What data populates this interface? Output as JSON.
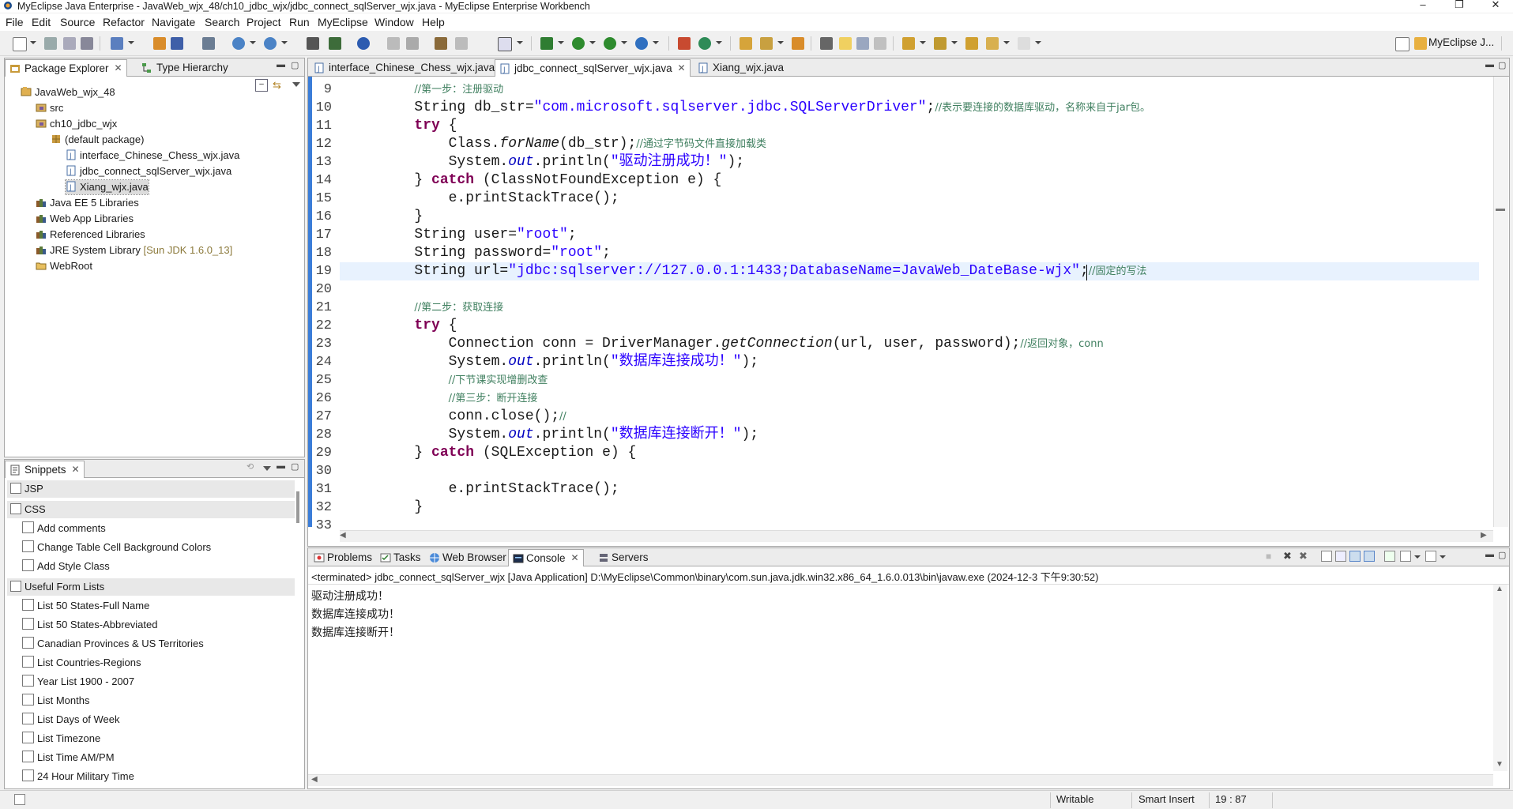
{
  "window": {
    "title": "MyEclipse Java Enterprise - JavaWeb_wjx_48/ch10_jdbc_wjx/jdbc_connect_sqlServer_wjx.java - MyEclipse Enterprise Workbench",
    "min": "–",
    "max": "❐",
    "close": "✕"
  },
  "menu": [
    "File",
    "Edit",
    "Source",
    "Refactor",
    "Navigate",
    "Search",
    "Project",
    "Run",
    "MyEclipse",
    "Window",
    "Help"
  ],
  "perspective": {
    "label": "MyEclipse J..."
  },
  "package_explorer": {
    "tabs": [
      {
        "label": "Package Explorer"
      },
      {
        "label": "Type Hierarchy"
      }
    ],
    "tree": [
      {
        "label": "JavaWeb_wjx_48",
        "indent": 0,
        "icon": "project-icon"
      },
      {
        "label": "src",
        "indent": 1,
        "icon": "source-folder-icon"
      },
      {
        "label": "ch10_jdbc_wjx",
        "indent": 1,
        "icon": "source-folder-icon"
      },
      {
        "label": "(default package)",
        "indent": 2,
        "icon": "package-icon"
      },
      {
        "label": "interface_Chinese_Chess_wjx.java",
        "indent": 3,
        "icon": "java-file-icon"
      },
      {
        "label": "jdbc_connect_sqlServer_wjx.java",
        "indent": 3,
        "icon": "java-file-icon"
      },
      {
        "label": "Xiang_wjx.java",
        "indent": 3,
        "icon": "java-file-icon",
        "selected": true
      },
      {
        "label": "Java EE 5 Libraries",
        "indent": 1,
        "icon": "library-icon"
      },
      {
        "label": "Web App Libraries",
        "indent": 1,
        "icon": "library-icon"
      },
      {
        "label": "Referenced Libraries",
        "indent": 1,
        "icon": "library-icon"
      },
      {
        "label": "JRE System Library",
        "decoration": "[Sun JDK 1.6.0_13]",
        "indent": 1,
        "icon": "library-icon"
      },
      {
        "label": "WebRoot",
        "indent": 1,
        "icon": "folder-icon"
      }
    ]
  },
  "snippets": {
    "tab": "Snippets",
    "groups": [
      {
        "label": "JSP",
        "items": []
      },
      {
        "label": "CSS",
        "items": [
          "Add comments",
          "Change Table Cell Background Colors",
          "Add Style Class"
        ]
      },
      {
        "label": "Useful Form Lists",
        "items": [
          "List 50 States-Full Name",
          "List 50 States-Abbreviated",
          "Canadian Provinces & US Territories",
          "List Countries-Regions",
          "Year List 1900 - 2007",
          "List Months",
          "List Days of Week",
          "List Timezone",
          "List Time AM/PM",
          "24 Hour Military Time"
        ]
      }
    ]
  },
  "editor": {
    "tabs": [
      {
        "label": "interface_Chinese_Chess_wjx.java",
        "active": false
      },
      {
        "label": "jdbc_connect_sqlServer_wjx.java",
        "active": true
      },
      {
        "label": "Xiang_wjx.java",
        "active": false
      }
    ],
    "current_line": 19,
    "lines": [
      {
        "n": "9",
        "html": "        <span class=\"cm\">//第一步：注册驱动</span>"
      },
      {
        "n": "10",
        "html": "        String db_str=<span class=\"str\">\"com.microsoft.sqlserver.jdbc.SQLServerDriver\"</span>;<span class=\"cm\">//表示要连接的数据库驱动，名称来自于jar包。</span>"
      },
      {
        "n": "11",
        "html": "        <span class=\"kw\">try</span> {"
      },
      {
        "n": "12",
        "html": "            Class.<span class=\"itb\">forName</span>(db_str);<span class=\"cm\">//通过字节码文件直接加载类</span>"
      },
      {
        "n": "13",
        "html": "            System.<span class=\"it\">out</span>.println(<span class=\"str\">\"驱动注册成功！\"</span>);"
      },
      {
        "n": "14",
        "html": "        } <span class=\"kw\">catch</span> (ClassNotFoundException e) {"
      },
      {
        "n": "15",
        "html": "            e.printStackTrace();"
      },
      {
        "n": "16",
        "html": "        }"
      },
      {
        "n": "17",
        "html": "        String user=<span class=\"str\">\"root\"</span>;"
      },
      {
        "n": "18",
        "html": "        String password=<span class=\"str\">\"root\"</span>;"
      },
      {
        "n": "19",
        "html": "        String url=<span class=\"str\">\"jdbc:sqlserver://127.0.0.1:1433;DatabaseName=JavaWeb_DateBase-wjx\"</span>;<span class=\"cm\">//固定的写法</span>"
      },
      {
        "n": "20",
        "html": ""
      },
      {
        "n": "21",
        "html": "        <span class=\"cm\">//第二步：获取连接</span>"
      },
      {
        "n": "22",
        "html": "        <span class=\"kw\">try</span> {"
      },
      {
        "n": "23",
        "html": "            Connection conn = DriverManager.<span class=\"itb\">getConnection</span>(url, user, password);<span class=\"cm\">//返回对象，conn</span>"
      },
      {
        "n": "24",
        "html": "            System.<span class=\"it\">out</span>.println(<span class=\"str\">\"数据库连接成功！\"</span>);"
      },
      {
        "n": "25",
        "html": "            <span class=\"cm\">//下节课实现增删改查</span>"
      },
      {
        "n": "26",
        "html": "            <span class=\"cm\">//第三步：断开连接</span>"
      },
      {
        "n": "27",
        "html": "            conn.close();<span class=\"cm\">//</span>"
      },
      {
        "n": "28",
        "html": "            System.<span class=\"it\">out</span>.println(<span class=\"str\">\"数据库连接断开！\"</span>);"
      },
      {
        "n": "29",
        "html": "        } <span class=\"kw\">catch</span> (SQLException e) {"
      },
      {
        "n": "30",
        "html": ""
      },
      {
        "n": "31",
        "html": "            e.printStackTrace();"
      },
      {
        "n": "32",
        "html": "        }"
      },
      {
        "n": "33",
        "html": ""
      }
    ]
  },
  "bottom": {
    "tabs": [
      {
        "label": "Problems",
        "icon": "problems-icon"
      },
      {
        "label": "Tasks",
        "icon": "tasks-icon"
      },
      {
        "label": "Web Browser",
        "icon": "globe-icon"
      },
      {
        "label": "Console",
        "icon": "console-icon",
        "active": true
      },
      {
        "label": "Servers",
        "icon": "servers-icon"
      }
    ],
    "console_header": "<terminated> jdbc_connect_sqlServer_wjx [Java Application] D:\\MyEclipse\\Common\\binary\\com.sun.java.jdk.win32.x86_64_1.6.0.013\\bin\\javaw.exe (2024-12-3 下午9:30:52)",
    "output": [
      "驱动注册成功！",
      "数据库连接成功！",
      "数据库连接断开！"
    ]
  },
  "status": {
    "writable": "Writable",
    "insert": "Smart Insert",
    "position": "19 : 87"
  },
  "colors": {
    "keyword": "#7f0055",
    "string": "#2a00ff",
    "comment": "#3f7f5f",
    "field": "#0000c0",
    "current_line": "#e8f2fe"
  }
}
